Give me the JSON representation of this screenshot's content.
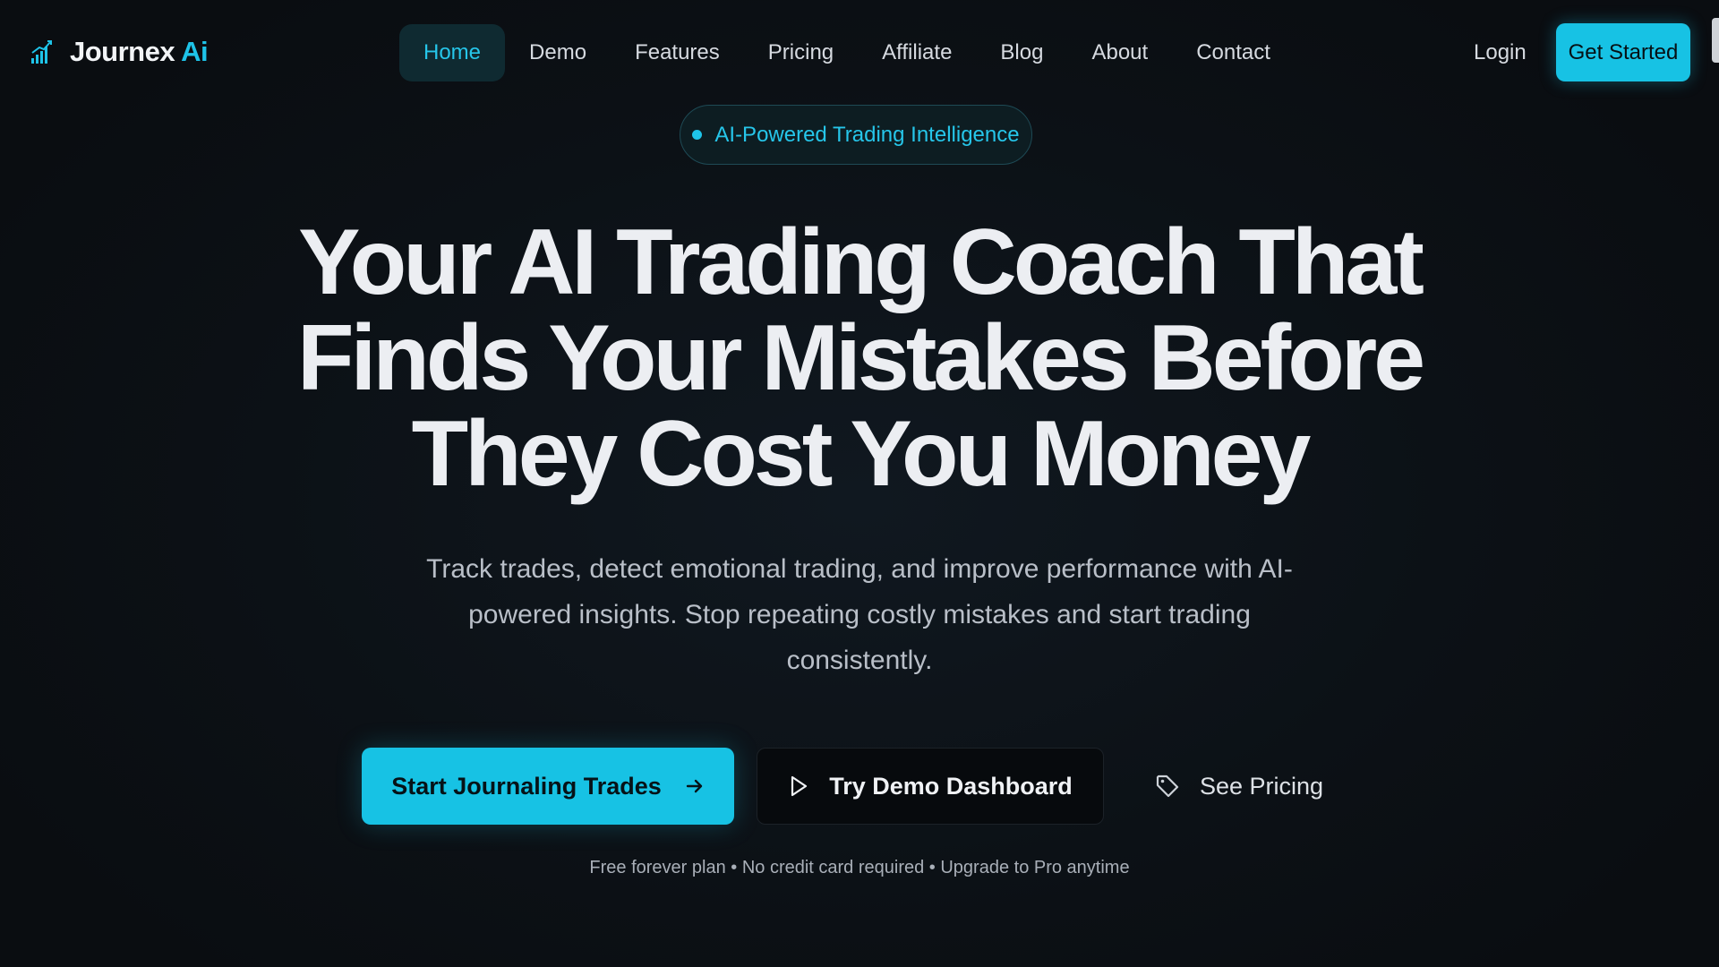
{
  "brand": {
    "name": "Journex",
    "accent": "Ai",
    "icon": "chart-bars-icon",
    "accent_color": "#1ec3e8"
  },
  "nav": {
    "items": [
      {
        "label": "Home",
        "active": true
      },
      {
        "label": "Demo"
      },
      {
        "label": "Features"
      },
      {
        "label": "Pricing"
      },
      {
        "label": "Affiliate"
      },
      {
        "label": "Blog"
      },
      {
        "label": "About"
      },
      {
        "label": "Contact"
      }
    ],
    "login": "Login",
    "get_started": "Get Started"
  },
  "badge": {
    "text": "AI-Powered Trading Intelligence"
  },
  "hero": {
    "headline_lines": [
      "Your AI Trading Coach That",
      "Finds Your Mistakes Before",
      "They Cost You Money"
    ],
    "subtitle": "Track trades, detect emotional trading, and improve performance with AI-powered insights. Stop repeating costly mistakes and start trading consistently."
  },
  "cta": {
    "primary": "Start Journaling Trades",
    "primary_icon": "arrow-right-icon",
    "demo": "Try Demo Dashboard",
    "demo_icon": "play-icon",
    "pricing": "See Pricing",
    "pricing_icon": "tag-icon"
  },
  "fine_print": "Free forever plan • No credit card required • Upgrade to Pro anytime"
}
